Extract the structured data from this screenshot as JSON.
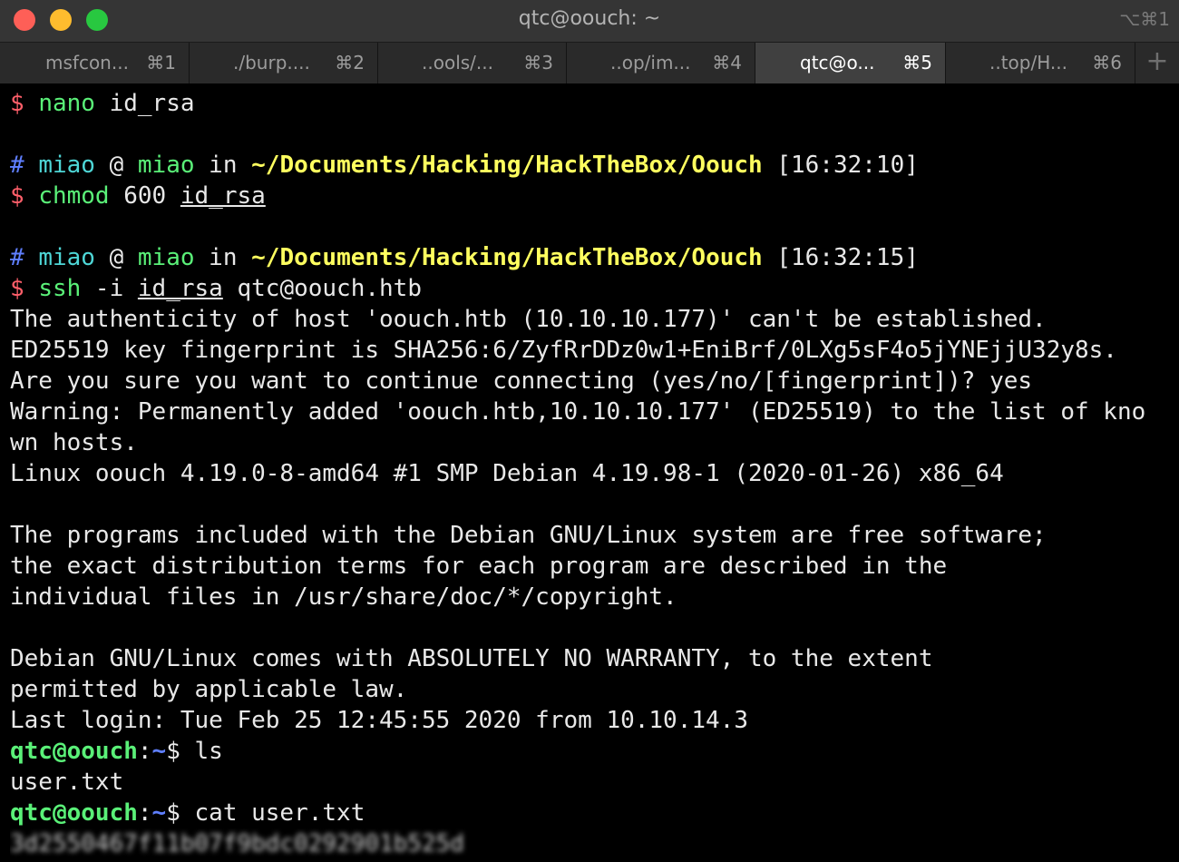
{
  "window": {
    "title": "qtc@oouch: ~",
    "shortcut": "⌥⌘1"
  },
  "tabs": [
    {
      "label": "msfcon...",
      "key": "⌘1",
      "active": false
    },
    {
      "label": "./burp....",
      "key": "⌘2",
      "active": false
    },
    {
      "label": "..ools/...",
      "key": "⌘3",
      "active": false
    },
    {
      "label": "..op/im...",
      "key": "⌘4",
      "active": false
    },
    {
      "label": "qtc@o...",
      "key": "⌘5",
      "active": true
    },
    {
      "label": "..top/H...",
      "key": "⌘6",
      "active": false
    }
  ],
  "add_tab_glyph": "+",
  "terminal": {
    "cmd1": {
      "prompt": "$",
      "command": "nano",
      "args": " id_rsa"
    },
    "info1": {
      "hash": "#",
      "user": "miao",
      "at": " @ ",
      "host": "miao",
      "in": " in ",
      "path": "~/Documents/Hacking/HackTheBox/Oouch",
      "time": " [16:32:10]"
    },
    "cmd2": {
      "prompt": "$",
      "command": "chmod",
      "args": " 600 ",
      "file": "id_rsa"
    },
    "info2": {
      "hash": "#",
      "user": "miao",
      "at": " @ ",
      "host": "miao",
      "in": " in ",
      "path": "~/Documents/Hacking/HackTheBox/Oouch",
      "time": " [16:32:15]"
    },
    "cmd3": {
      "prompt": "$",
      "command": "ssh",
      "args": " -i ",
      "file": "id_rsa",
      "rest": " qtc@oouch.htb"
    },
    "output": [
      "The authenticity of host 'oouch.htb (10.10.10.177)' can't be established.",
      "ED25519 key fingerprint is SHA256:6/ZyfRrDDz0w1+EniBrf/0LXg5sF4o5jYNEjjU32y8s.",
      "Are you sure you want to continue connecting (yes/no/[fingerprint])? yes",
      "Warning: Permanently added 'oouch.htb,10.10.10.177' (ED25519) to the list of kno",
      "wn hosts.",
      "Linux oouch 4.19.0-8-amd64 #1 SMP Debian 4.19.98-1 (2020-01-26) x86_64",
      "",
      "The programs included with the Debian GNU/Linux system are free software;",
      "the exact distribution terms for each program are described in the",
      "individual files in /usr/share/doc/*/copyright.",
      "",
      "Debian GNU/Linux comes with ABSOLUTELY NO WARRANTY, to the extent",
      "permitted by applicable law.",
      "Last login: Tue Feb 25 12:45:55 2020 from 10.10.14.3"
    ],
    "remote1": {
      "user_host": "qtc@oouch",
      "colon": ":",
      "dir": "~",
      "prompt": "$ ",
      "command": "ls"
    },
    "ls_output": "user.txt",
    "remote2": {
      "user_host": "qtc@oouch",
      "colon": ":",
      "dir": "~",
      "prompt": "$ ",
      "command": "cat user.txt"
    },
    "redacted_output": "3d2550467f11b07f9bdc0292901b525d"
  }
}
